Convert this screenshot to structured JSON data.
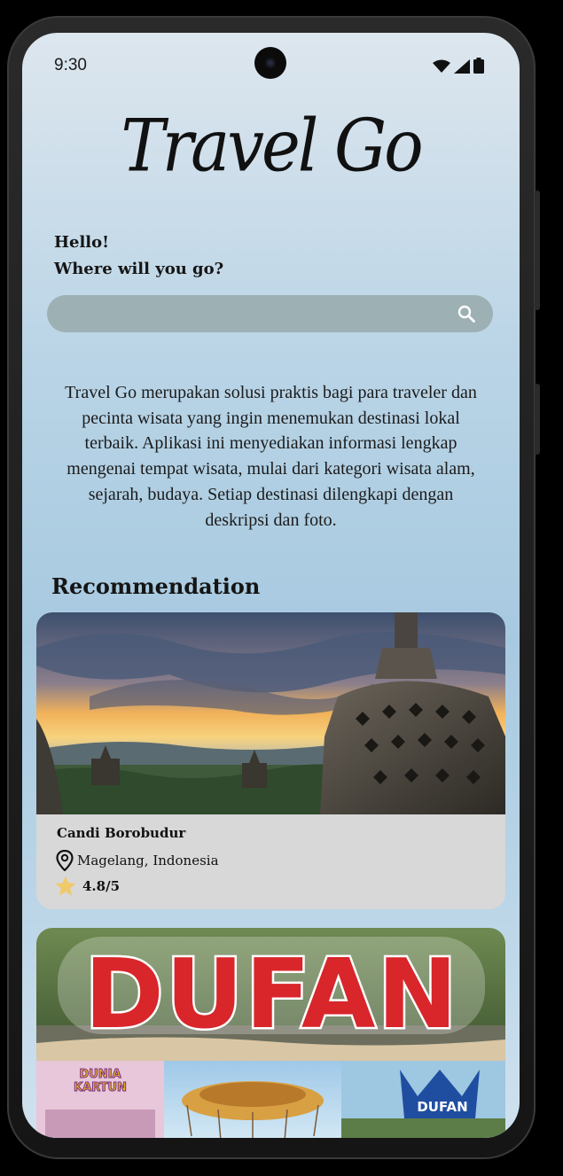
{
  "status_bar": {
    "time": "9:30",
    "icons": [
      "wifi-icon",
      "signal-icon",
      "battery-icon"
    ]
  },
  "app": {
    "title": "Travel Go"
  },
  "greeting": {
    "line1": "Hello!",
    "line2": "Where will you go?"
  },
  "search": {
    "value": "",
    "placeholder": "",
    "icon": "search-icon"
  },
  "description": "Travel Go merupakan solusi praktis bagi para traveler dan pecinta wisata yang ingin menemukan destinasi lokal terbaik. Aplikasi ini menyediakan informasi lengkap mengenai tempat wisata, mulai dari kategori wisata alam, sejarah, budaya. Setiap destinasi dilengkapi dengan deskripsi dan foto.",
  "recommendation": {
    "title": "Recommendation",
    "items": [
      {
        "name": "Candi Borobudur",
        "location": "Magelang, Indonesia",
        "rating": "4.8/5"
      },
      {
        "image_text": "DUFAN",
        "thumb_texts": [
          "DUNIA KARTUN",
          "DUFAN"
        ]
      }
    ]
  },
  "colors": {
    "search_bg": "#9db0b4",
    "card_bg": "#d8d8d8",
    "star": "#f0c96a",
    "dufan_red": "#d8262b"
  }
}
